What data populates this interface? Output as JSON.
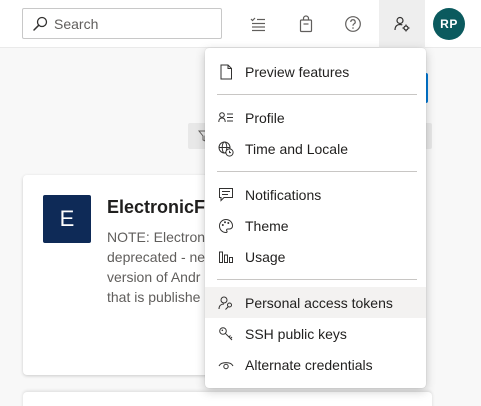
{
  "search": {
    "placeholder": "Search"
  },
  "header": {
    "icons": [
      "work-items-icon",
      "marketplace-bag-icon",
      "help-icon",
      "user-settings-icon"
    ],
    "avatar_initials": "RP"
  },
  "card": {
    "logo_letter": "E",
    "title": "ElectronicFi",
    "description_lines": [
      "NOTE: Electron",
      "deprecated - ne",
      "version of Andr",
      "that is publishe"
    ]
  },
  "menu": {
    "items": [
      {
        "label": "Preview features",
        "icon": "preview-features-icon"
      },
      {
        "label": "Profile",
        "icon": "profile-icon"
      },
      {
        "label": "Time and Locale",
        "icon": "globe-clock-icon"
      },
      {
        "label": "Notifications",
        "icon": "notifications-icon"
      },
      {
        "label": "Theme",
        "icon": "palette-icon"
      },
      {
        "label": "Usage",
        "icon": "usage-chart-icon"
      },
      {
        "label": "Personal access tokens",
        "icon": "token-person-icon",
        "selected": true
      },
      {
        "label": "SSH public keys",
        "icon": "ssh-key-icon"
      },
      {
        "label": "Alternate credentials",
        "icon": "eye-icon"
      }
    ]
  },
  "colors": {
    "avatar_bg": "#0b5a5e",
    "card_logo_bg": "#0e2a57",
    "accent": "#0078d4",
    "selected_item_bg": "#f3f2f1"
  }
}
